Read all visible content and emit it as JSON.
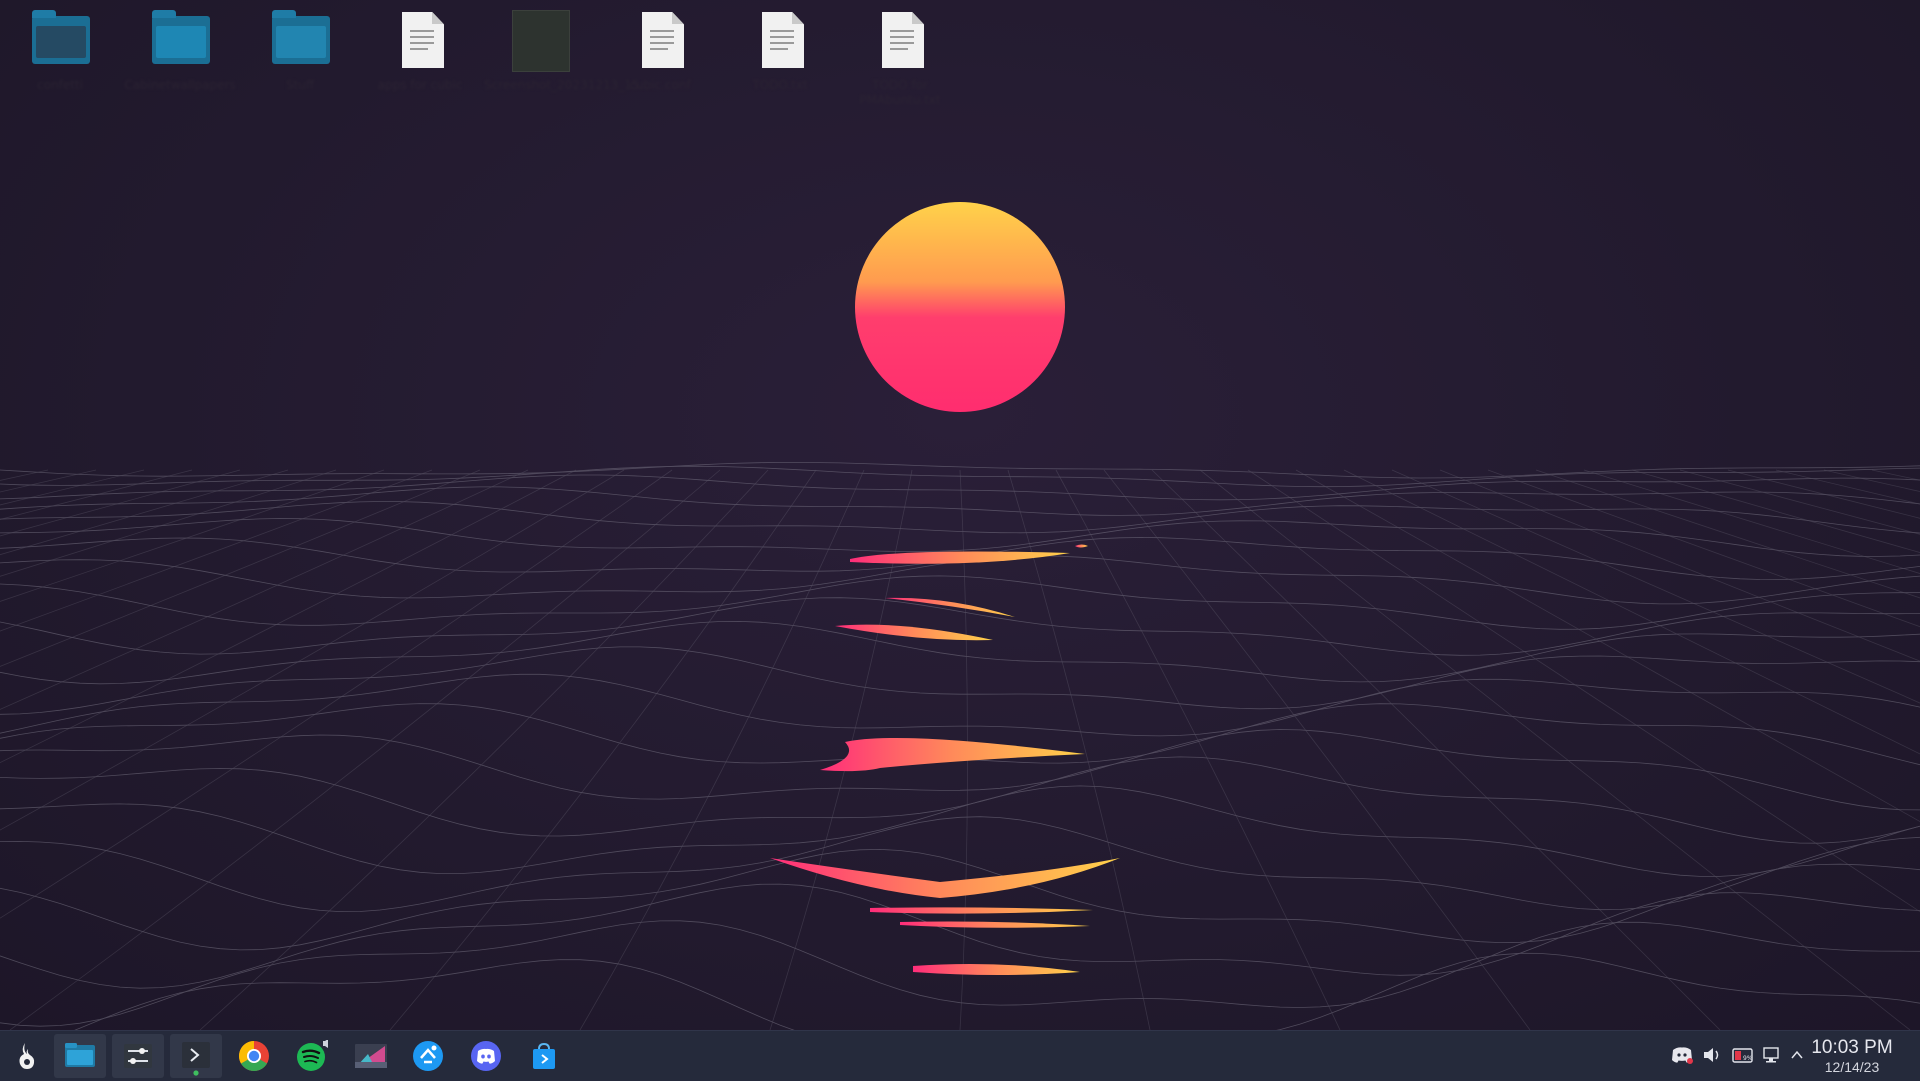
{
  "desktop": {
    "icons": [
      {
        "label": "confetti",
        "kind": "folder"
      },
      {
        "label": "Cabinetwallpapers",
        "kind": "folder"
      },
      {
        "label": "Stuff",
        "kind": "folder"
      },
      {
        "label": "apps for cubic",
        "kind": "document"
      },
      {
        "label": "Screenshot_20231213_15...",
        "kind": "image"
      },
      {
        "label": "cubic.conf",
        "kind": "document"
      },
      {
        "label": "TODO.txt",
        "kind": "document"
      },
      {
        "label": "TODO for PMAbuntu.txt",
        "kind": "document"
      }
    ]
  },
  "taskbar": {
    "launcher_icon": "kde-launcher-icon",
    "apps": [
      {
        "name": "file-manager",
        "icon": "folder-icon",
        "active": true
      },
      {
        "name": "system-settings",
        "icon": "settings-sliders-icon",
        "active": true
      },
      {
        "name": "terminal",
        "icon": "terminal-icon",
        "active": true
      },
      {
        "name": "chrome",
        "icon": "chrome-icon",
        "active": false
      },
      {
        "name": "spotify",
        "icon": "spotify-icon",
        "active": false
      },
      {
        "name": "krita",
        "icon": "krita-icon",
        "active": false
      },
      {
        "name": "kdeconnect",
        "icon": "kdeconnect-icon",
        "active": false
      },
      {
        "name": "discord",
        "icon": "discord-icon",
        "active": false
      },
      {
        "name": "discover",
        "icon": "store-bag-icon",
        "active": false
      }
    ],
    "tray": {
      "icons": [
        "discord-tray-icon",
        "volume-icon",
        "battery-icon",
        "network-icon",
        "expand-arrow-icon"
      ]
    },
    "clock": {
      "time": "10:03 PM",
      "date": "12/14/23"
    }
  },
  "colors": {
    "background": "#221a2e",
    "sun_top": "#ffd24a",
    "sun_bottom": "#ff2d6f",
    "taskbar": "#252a3b",
    "grid": "#8a8796"
  }
}
